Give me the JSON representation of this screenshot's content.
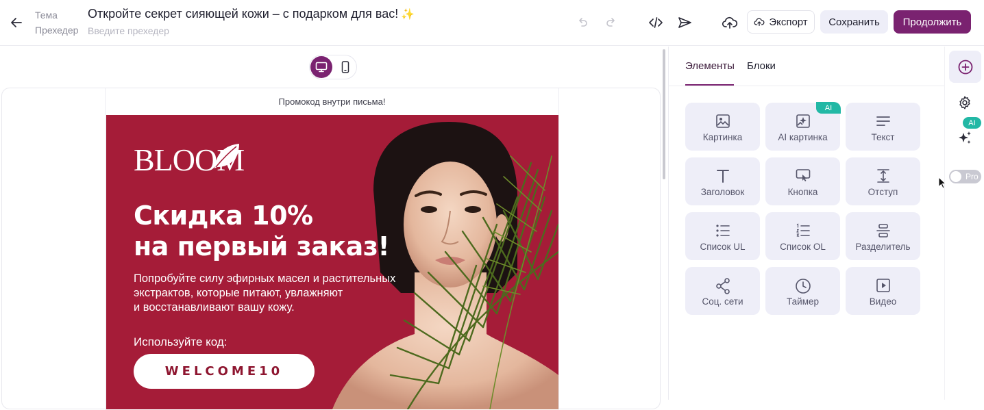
{
  "header": {
    "back_icon": "arrow-left-icon",
    "subject_label": "Тема",
    "preheader_label": "Прехедер",
    "subject": "Откройте секрет сияющей кожи – с подарком для вас!",
    "subject_emoji": "✨",
    "preheader_value": "",
    "preheader_placeholder": "Введите прехедер",
    "undo_icon": "undo-icon",
    "redo_icon": "redo-icon",
    "code_icon": "code-icon",
    "send_icon": "send-icon",
    "upload_icon": "cloud-upload-icon",
    "export_label": "Экспорт",
    "save_label": "Сохранить",
    "continue_label": "Продолжить"
  },
  "canvas": {
    "device_modes": [
      "desktop",
      "mobile"
    ],
    "active_device": "desktop",
    "email": {
      "promo_line": "Промокод внутри письма!",
      "logo": "BLOOM",
      "headline_1": "Скидка 10%",
      "headline_2": "на первый заказ!",
      "body_1": "Попробуйте силу эфирных масел и растительных",
      "body_2": "экстрактов, которые питают, увлажняют",
      "body_3": "и восстанавливают вашу кожу.",
      "code_label": "Используйте код:",
      "code": "WELCOME10"
    }
  },
  "panel": {
    "tabs": [
      {
        "label": "Элементы",
        "active": true
      },
      {
        "label": "Блоки",
        "active": false
      }
    ],
    "elements": [
      {
        "label": "Картинка",
        "icon": "image-icon"
      },
      {
        "label": "AI картинка",
        "icon": "ai-image-icon",
        "badge": "AI"
      },
      {
        "label": "Текст",
        "icon": "text-icon"
      },
      {
        "label": "Заголовок",
        "icon": "heading-icon"
      },
      {
        "label": "Кнопка",
        "icon": "button-click-icon"
      },
      {
        "label": "Отступ",
        "icon": "spacer-icon"
      },
      {
        "label": "Список UL",
        "icon": "bullet-list-icon"
      },
      {
        "label": "Список OL",
        "icon": "numbered-list-icon"
      },
      {
        "label": "Разделитель",
        "icon": "divider-icon"
      },
      {
        "label": "Соц. сети",
        "icon": "share-icon"
      },
      {
        "label": "Таймер",
        "icon": "clock-icon"
      },
      {
        "label": "Видео",
        "icon": "video-icon"
      }
    ]
  },
  "rail": {
    "add_icon": "plus-circle-icon",
    "settings_icon": "gear-icon",
    "ai_badge": "AI",
    "ai_icon": "sparkles-icon",
    "pro_label": "Pro",
    "pro_enabled": false
  },
  "colors": {
    "brand": "#7a2270",
    "banner": "#a51c38",
    "tile_bg": "#eeeef8",
    "ai_badge": "#22b8a5"
  }
}
